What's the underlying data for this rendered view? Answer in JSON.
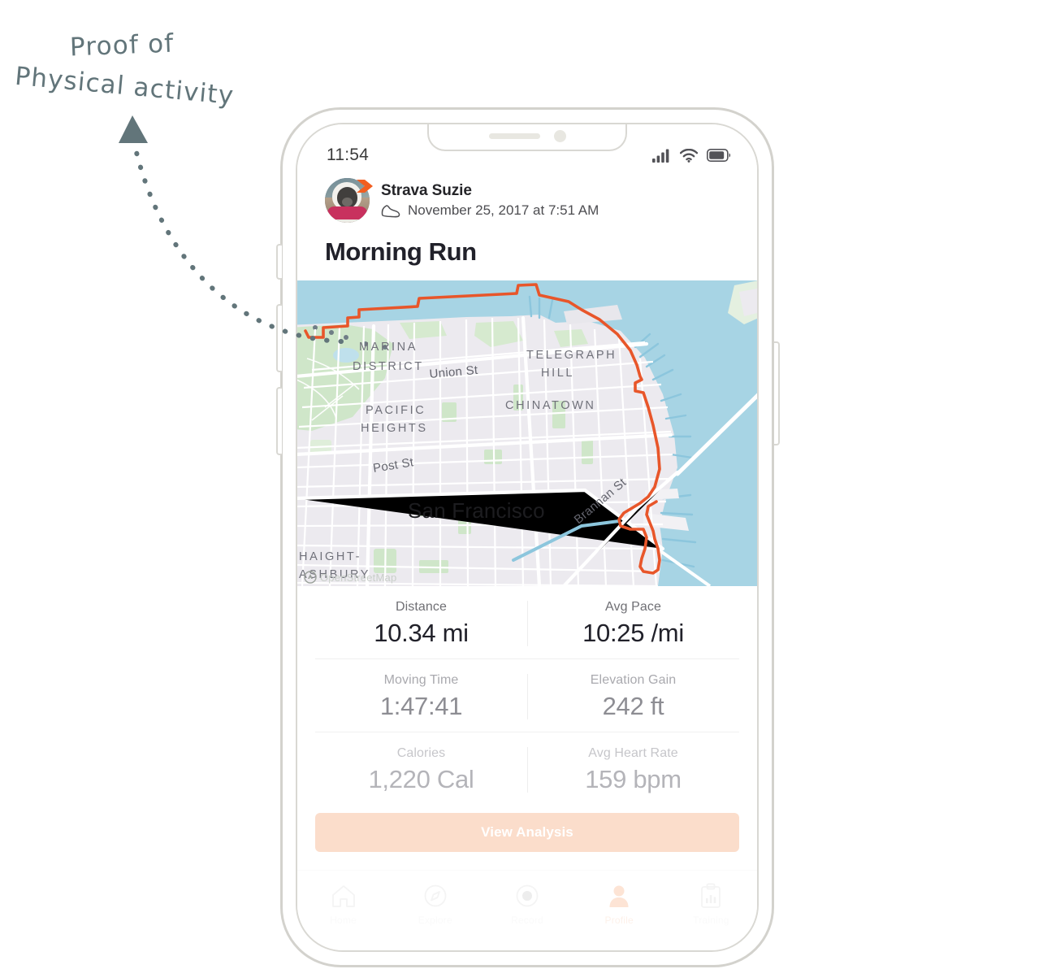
{
  "annotation": {
    "line1": "Proof of",
    "line2": "Physical activity",
    "color": "#62757a",
    "arrow_icon": "arrow-triangle-icon",
    "connector_icon": "dotted-curve-icon"
  },
  "phone": {
    "device": "smartphone-mockup",
    "frame_color": "#d3d2cd",
    "buttons": {
      "mute": "mute-switch",
      "volume_up": "volume-up-button",
      "volume_down": "volume-down-button",
      "power": "power-button"
    },
    "notch": {
      "speaker": "speaker-grill",
      "camera": "front-camera"
    }
  },
  "status_bar": {
    "time": "11:54",
    "icons": [
      "cellular-signal-icon",
      "wifi-icon",
      "battery-icon"
    ]
  },
  "activity": {
    "athlete_name": "Strava Suzie",
    "avatar": "dog-profile-photo",
    "badge_icon": "strava-chevron-icon",
    "sport_icon": "running-shoe-icon",
    "date": "November 25, 2017 at 7:51 AM",
    "title": "Morning Run"
  },
  "map": {
    "route_color": "#e8562a",
    "water_color": "#a7d4e4",
    "land_color": "#eceaef",
    "park_color": "#cde8cc",
    "city_label": "San Francisco",
    "attribution": "OpenStreetMap",
    "attribution_icon": "strava-logo-icon",
    "neighborhoods": [
      "MARINA DISTRICT",
      "TELEGRAPH HILL",
      "PACIFIC HEIGHTS",
      "CHINATOWN",
      "HAIGHT-ASHBURY"
    ],
    "streets": [
      "Union St",
      "Post St",
      "Brannan St"
    ]
  },
  "stats": {
    "rows": [
      [
        {
          "label": "Distance",
          "value": "10.34 mi"
        },
        {
          "label": "Avg Pace",
          "value": "10:25 /mi"
        }
      ],
      [
        {
          "label": "Moving Time",
          "value": "1:47:41"
        },
        {
          "label": "Elevation Gain",
          "value": "242 ft"
        }
      ],
      [
        {
          "label": "Calories",
          "value": "1,220 Cal"
        },
        {
          "label": "Avg Heart Rate",
          "value": "159 bpm"
        }
      ]
    ]
  },
  "cta": {
    "label": "View Analysis",
    "color": "#fbddcb"
  },
  "tabbar": {
    "items": [
      {
        "label": "Home",
        "icon": "home-icon"
      },
      {
        "label": "Explore",
        "icon": "compass-icon"
      },
      {
        "label": "Record",
        "icon": "record-icon"
      },
      {
        "label": "Profile",
        "icon": "person-icon"
      },
      {
        "label": "Training",
        "icon": "clipboard-chart-icon"
      }
    ],
    "active_index": 3
  }
}
